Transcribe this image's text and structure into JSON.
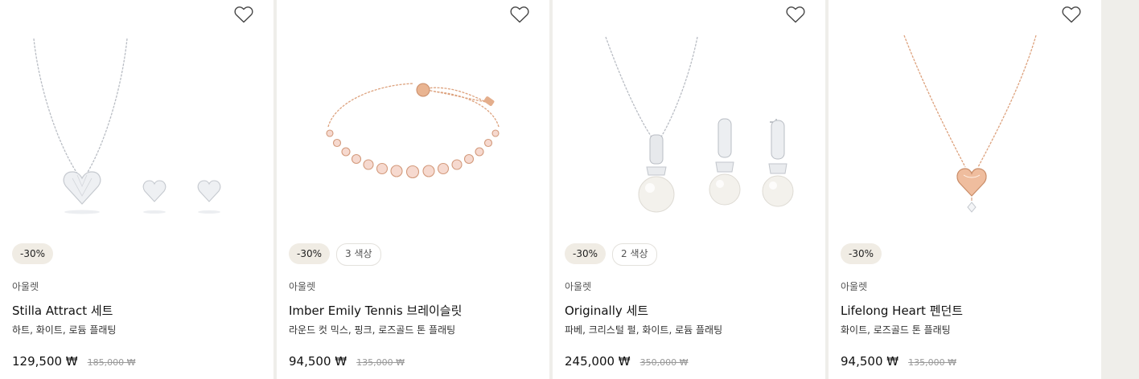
{
  "products": [
    {
      "image_icon": "necklace-earring-set-image",
      "discount": "-30%",
      "colors": "",
      "brand": "아울렛",
      "name": "Stilla Attract 세트",
      "variant": "하트, 화이트, 로듐 플래팅",
      "price": "129,500 ₩",
      "original_price": "185,000 ₩"
    },
    {
      "image_icon": "tennis-bracelet-image",
      "discount": "-30%",
      "colors": "3 색상",
      "brand": "아울렛",
      "name": "Imber Emily Tennis 브레이슬릿",
      "variant": "라운드 컷 믹스, 핑크, 로즈골드 톤 플래팅",
      "price": "94,500 ₩",
      "original_price": "135,000 ₩"
    },
    {
      "image_icon": "pearl-pendant-earring-set-image",
      "discount": "-30%",
      "colors": "2 색상",
      "brand": "아울렛",
      "name": "Originally 세트",
      "variant": "파베, 크리스털 펄, 화이트, 로듐 플래팅",
      "price": "245,000 ₩",
      "original_price": "350,000 ₩"
    },
    {
      "image_icon": "heart-pendant-image",
      "discount": "-30%",
      "colors": "",
      "brand": "아울렛",
      "name": "Lifelong Heart 펜던트",
      "variant": "화이트, 로즈골드 톤 플래팅",
      "price": "94,500 ₩",
      "original_price": "135,000 ₩"
    }
  ],
  "icons": {
    "wishlist": "heart-outline-icon"
  },
  "colors": {
    "page_bg": "#efeeea",
    "card_bg": "#ffffff",
    "badge_bg": "#f0ece4",
    "silver": "#bfc3c9",
    "rose_gold": "#e0a381",
    "pearl": "#f3f1ec"
  }
}
